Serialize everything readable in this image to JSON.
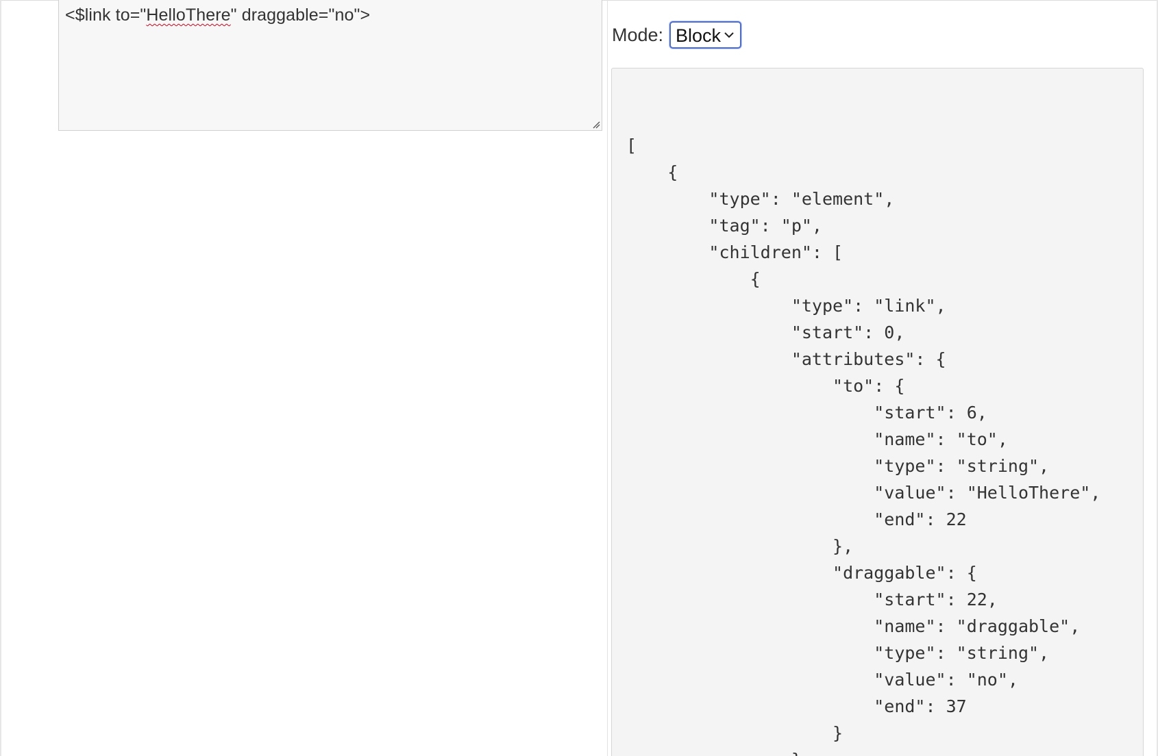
{
  "editor": {
    "before": "<$link to=\"",
    "misspelled": "HelloThere",
    "after": "\" draggable=\"no\">"
  },
  "mode": {
    "label": "Mode:",
    "selected": "Block"
  },
  "output": {
    "lines": [
      "[",
      "    {",
      "        \"type\": \"element\",",
      "        \"tag\": \"p\",",
      "        \"children\": [",
      "            {",
      "                \"type\": \"link\",",
      "                \"start\": 0,",
      "                \"attributes\": {",
      "                    \"to\": {",
      "                        \"start\": 6,",
      "                        \"name\": \"to\",",
      "                        \"type\": \"string\",",
      "                        \"value\": \"HelloThere\",",
      "                        \"end\": 22",
      "                    },",
      "                    \"draggable\": {",
      "                        \"start\": 22,",
      "                        \"name\": \"draggable\",",
      "                        \"type\": \"string\",",
      "                        \"value\": \"no\",",
      "                        \"end\": 37",
      "                    }",
      "                },"
    ]
  },
  "colors": {
    "select_border": "#4a6cd4",
    "spellcheck_underline": "#d0021b",
    "panel_background": "#f4f4f4"
  },
  "icons": {
    "dropdown": "chevron-down-icon",
    "resize": "resize-grip-icon"
  }
}
